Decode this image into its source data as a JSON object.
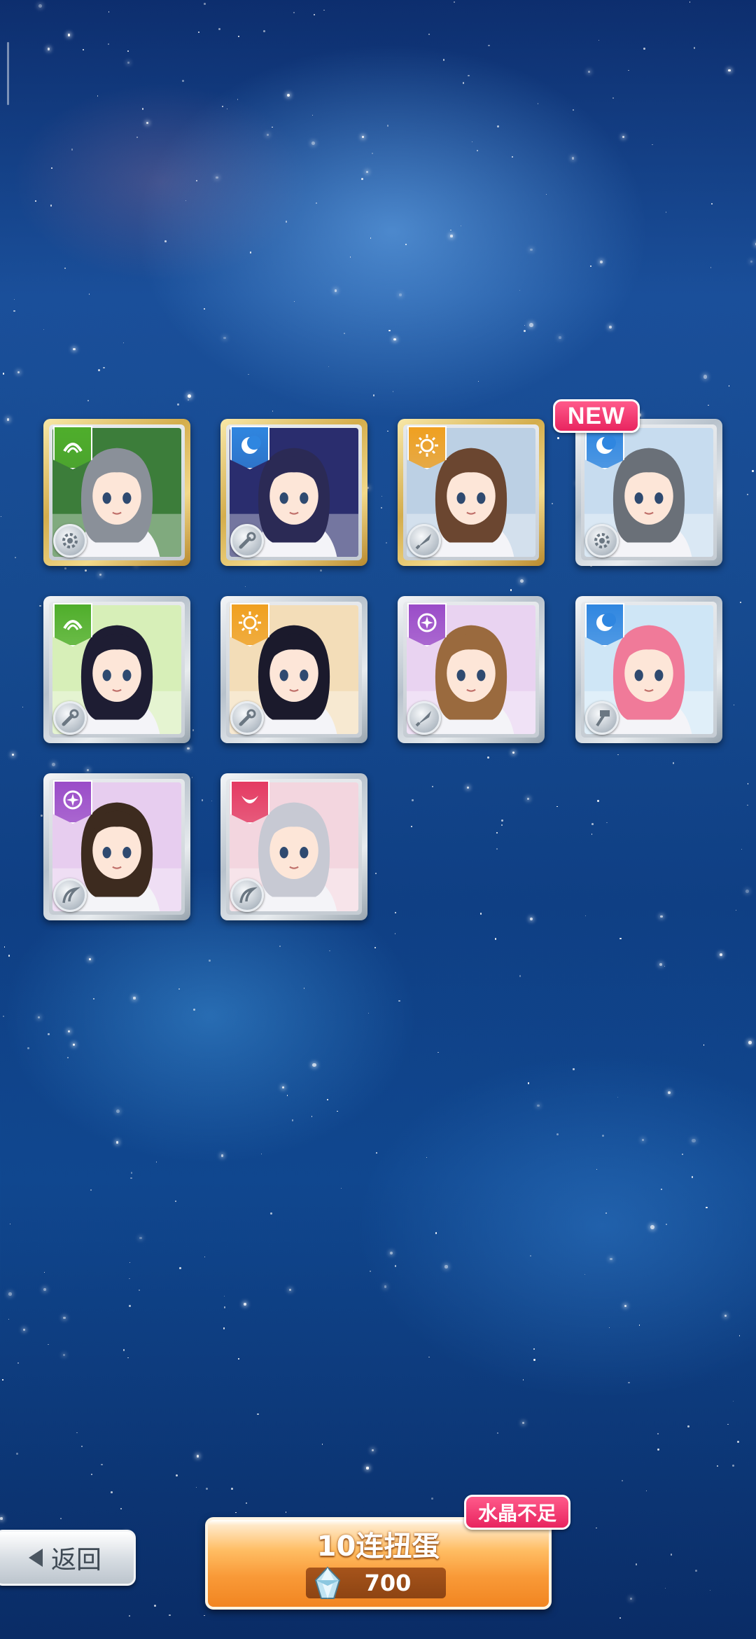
{
  "new_tag": "NEW",
  "colors": {
    "attr_green": "#4fae2b",
    "attr_blue": "#2f86e0",
    "attr_orange": "#f0a020",
    "attr_purple": "#9a4cc8",
    "attr_red": "#e43a62"
  },
  "cards": [
    {
      "frame": "gold",
      "attribute": "green",
      "attribute_icon": "wind-icon",
      "weapon_icon": "gear-icon",
      "hair": "#8a9099",
      "bg": "#3c7d3a"
    },
    {
      "frame": "gold",
      "attribute": "blue",
      "attribute_icon": "moon-icon",
      "weapon_icon": "wrench-icon",
      "hair": "#2b2a55",
      "bg": "#2a2d6e"
    },
    {
      "frame": "gold",
      "attribute": "orange",
      "attribute_icon": "sun-icon",
      "weapon_icon": "drill-icon",
      "hair": "#6b4630",
      "bg": "#bcd0e4"
    },
    {
      "frame": "silver",
      "attribute": "blue",
      "attribute_icon": "moon-icon",
      "weapon_icon": "gear-icon",
      "hair": "#6a7078",
      "bg": "#c7dcef",
      "new": true
    },
    {
      "frame": "silver",
      "attribute": "green",
      "attribute_icon": "wind-icon",
      "weapon_icon": "wrench-icon",
      "hair": "#1e1d33",
      "bg": "#d7efb8"
    },
    {
      "frame": "silver",
      "attribute": "orange",
      "attribute_icon": "sun-icon",
      "weapon_icon": "wrench-icon",
      "hair": "#1b1a2c",
      "bg": "#f3ddb8"
    },
    {
      "frame": "silver",
      "attribute": "purple",
      "attribute_icon": "sparkle-icon",
      "weapon_icon": "drill-icon",
      "hair": "#9a6a3e",
      "bg": "#e9d3f1"
    },
    {
      "frame": "silver",
      "attribute": "blue",
      "attribute_icon": "moon-icon",
      "weapon_icon": "hammer-icon",
      "hair": "#f07a99",
      "bg": "#cfe6f6"
    },
    {
      "frame": "silver",
      "attribute": "purple",
      "attribute_icon": "sparkle-icon",
      "weapon_icon": "whip-icon",
      "hair": "#3d2b1f",
      "bg": "#e7cdef"
    },
    {
      "frame": "silver",
      "attribute": "red",
      "attribute_icon": "crescent-icon",
      "weapon_icon": "whip-icon",
      "hair": "#c7c9d3",
      "bg": "#f3d6df"
    }
  ],
  "back_button": {
    "label": "返回",
    "icon": "back-arrow-icon"
  },
  "gacha_button": {
    "label": "10连扭蛋",
    "cost": "700",
    "currency_icon": "crystal-icon"
  },
  "insufficient_tag": "水晶不足"
}
